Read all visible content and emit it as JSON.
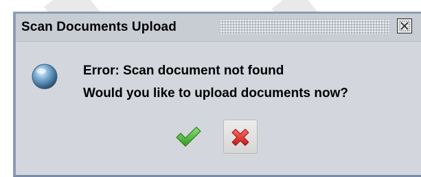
{
  "dialog": {
    "title": "Scan Documents Upload",
    "message_line1": "Error: Scan document not found",
    "message_line2": "Would you like to upload documents now?",
    "icons": {
      "info": "info-globe-icon",
      "close": "close-icon",
      "confirm": "checkmark-icon",
      "cancel": "x-icon"
    }
  },
  "colors": {
    "dialog_background": "#d3d6dc",
    "border": "#8b9bb8",
    "confirm_green": "#3fae2a",
    "cancel_red": "#d42a2a"
  }
}
